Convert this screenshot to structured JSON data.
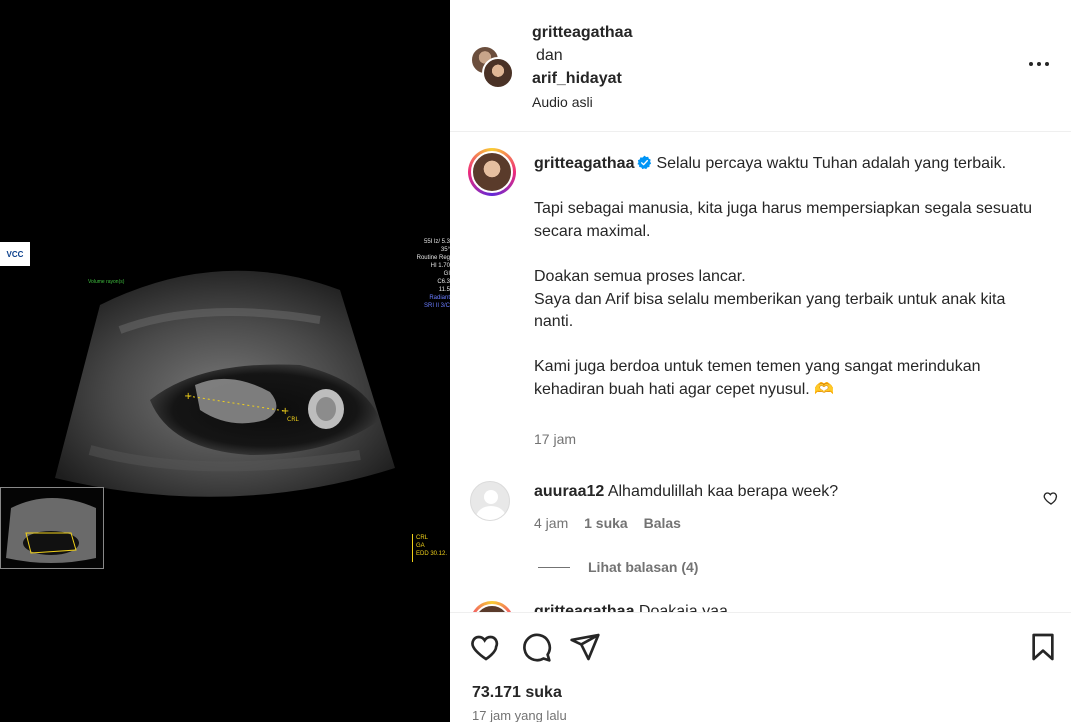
{
  "media": {
    "logo_text": "VCC",
    "green_label": "Volume\nrayon(s)",
    "info_lines": [
      "55I lz/ 5.3",
      "35°",
      "Routine Reg",
      "HI 1.70",
      "GI",
      "C6.3",
      "11.5"
    ],
    "info_blue": "Radiant",
    "info_blue2": "SRI II 3/C",
    "crl_label": "CRL",
    "measure_lines": [
      "CRL",
      "GA",
      "EDD 30.12."
    ]
  },
  "header": {
    "user1": "gritteagathaa",
    "connector": "dan",
    "user2": "arif_hidayat",
    "audio": "Audio asli"
  },
  "caption": {
    "username": "gritteagathaa",
    "line1": "Selalu percaya waktu Tuhan adalah yang terbaik.",
    "line2": "Tapi sebagai manusia, kita juga harus mempersiapkan segala sesuatu secara maximal.",
    "line3": "Doakan semua proses lancar.",
    "line4": "Saya dan Arif bisa selalu memberikan yang terbaik untuk anak kita nanti.",
    "line5": "Kami juga berdoa untuk temen temen yang sangat merindukan kehadiran buah hati agar cepet nyusul. 🫶",
    "time": "17 jam"
  },
  "comment": {
    "username": "auuraa12",
    "text": "Alhamdulillah kaa berapa week?",
    "time": "4 jam",
    "likes": "1 suka",
    "reply": "Balas",
    "view_replies": "Lihat balasan (4)"
  },
  "next_comment": {
    "username": "gritteagathaa",
    "text": "Doakaja yaa..."
  },
  "footer": {
    "likes": "73.171 suka",
    "time": "17 jam yang lalu"
  },
  "colors": {
    "verified": "#0095f6",
    "muted": "#737373",
    "text": "#262626"
  }
}
